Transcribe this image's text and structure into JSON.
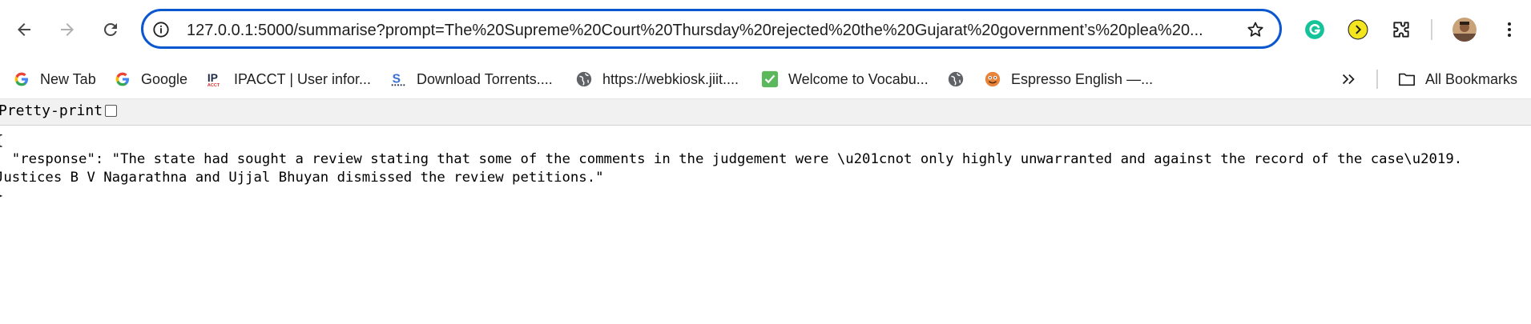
{
  "browser": {
    "url": "127.0.0.1:5000/summarise?prompt=The%20Supreme%20Court%20Thursday%20rejected%20the%20Gujarat%20government’s%20plea%20..."
  },
  "bookmarks": [
    {
      "label": "New Tab",
      "icon": "google-icon"
    },
    {
      "label": "Google",
      "icon": "google-icon"
    },
    {
      "label": "IPACCT | User infor...",
      "icon": "ipacct-icon"
    },
    {
      "label": "Download Torrents....",
      "icon": "torrent-icon"
    },
    {
      "label": "https://webkiosk.jiit....",
      "icon": "globe-icon"
    },
    {
      "label": "Welcome to Vocabu...",
      "icon": "vocab-check-icon"
    },
    {
      "label": "",
      "icon": "globe-icon"
    },
    {
      "label": "Espresso English —...",
      "icon": "espresso-icon"
    }
  ],
  "all_bookmarks_label": "All Bookmarks",
  "pretty_print": {
    "label": "Pretty-print",
    "checked": false
  },
  "json_text": {
    "open": "{",
    "line1": "  \"response\": \"The state had sought a review stating that some of the comments in the judgement were \\u201cnot only highly unwarranted and against the record of the case\\u2019.",
    "line2": "Justices B V Nagarathna and Ujjal Bhuyan dismissed the review petitions.\"",
    "close": "}"
  },
  "colors": {
    "accent": "#0b57d0",
    "grammarly": "#15c39a",
    "yellow_ext": "#f4e61e"
  }
}
